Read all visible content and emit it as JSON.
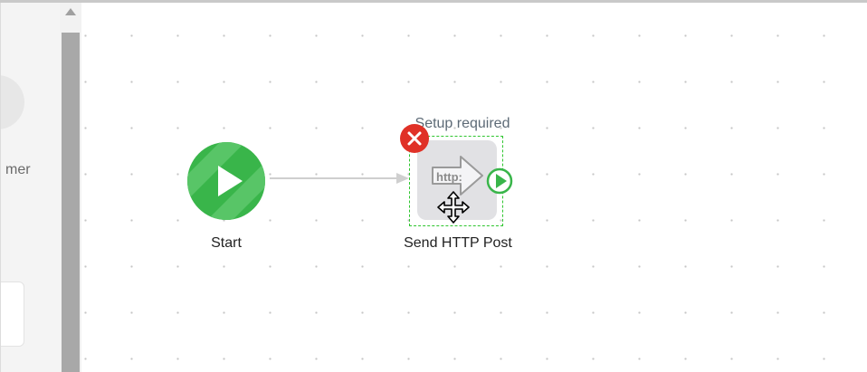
{
  "sidebar": {
    "partial_label": "mer"
  },
  "canvas": {
    "nodes": [
      {
        "label": "Start",
        "icon": "play-icon"
      },
      {
        "label": "Send HTTP Post",
        "icon": "http-arrow-icon",
        "icon_text": "http:",
        "status": "Setup required"
      }
    ]
  },
  "colors": {
    "start": "#39b54a",
    "selection": "#2ec52e",
    "error": "#e03127"
  }
}
